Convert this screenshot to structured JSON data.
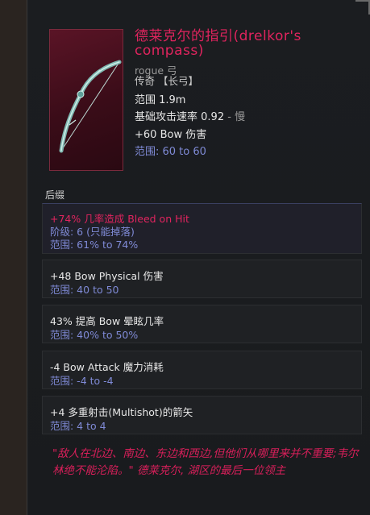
{
  "item": {
    "name": "德莱克尔的指引(drelkor's compass)",
    "class": "rogue",
    "type": "弓",
    "rarity_line": "传奇 【长弓】",
    "range": "范围 1.9m",
    "attack_speed_label": "基础攻击速率",
    "attack_speed_value": "0.92",
    "attack_speed_suffix": "- 慢",
    "base_damage": "+60 Bow 伤害",
    "base_damage_range": "范围: 60 to 60"
  },
  "affixes_label": "后缀",
  "affixes": [
    {
      "line1": "+74% 几率造成 Bleed on Hit",
      "line2": "阶级: 6 (只能掉落)",
      "line3": "范围: 61% to 74%"
    },
    {
      "line1": "+48 Bow Physical 伤害",
      "line2": "范围: 40 to 50"
    },
    {
      "line1": "43% 提高 Bow 晕眩几率",
      "line2": "范围: 40% to 50%"
    },
    {
      "line1": "-4 Bow Attack 魔力消耗",
      "line2": "范围: -4 to -4"
    },
    {
      "line1": "+4 多重射击(Multishot)的箭矢",
      "line2": "范围: 4 to 4"
    }
  ],
  "lore": "\"敌人在北边、南边、东边和西边,但他们从哪里来并不重要;韦尔林绝不能沦陷。\" 德莱克尔, 湖区的最后一位领主",
  "colors": {
    "legendary": "#e0245e",
    "range_text": "#7f8ad6",
    "background": "#1b1d20"
  },
  "icons": {
    "item_image": "bow-icon"
  }
}
